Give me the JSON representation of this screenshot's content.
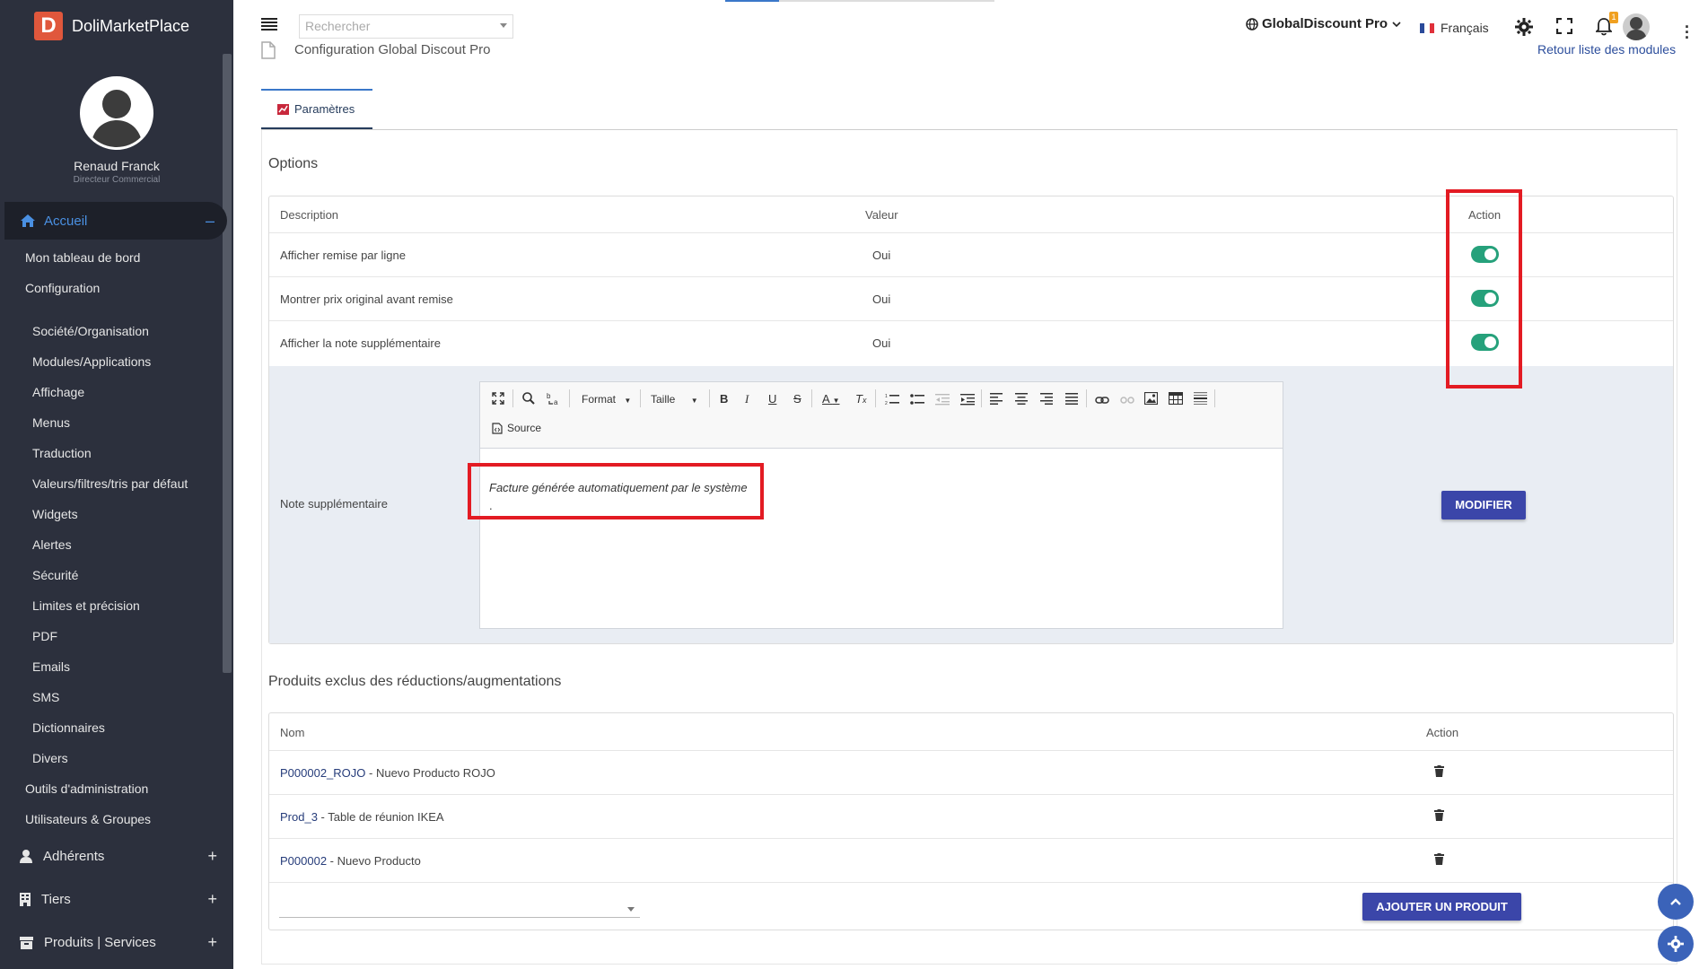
{
  "brand": {
    "logo_letter": "D",
    "name": "DoliMarketPlace"
  },
  "user": {
    "name": "Renaud Franck",
    "role": "Directeur Commercial"
  },
  "sidebar": {
    "main_item": "Accueil",
    "sub_items": [
      "Mon tableau de bord",
      "Configuration"
    ],
    "config_items": [
      "Société/Organisation",
      "Modules/Applications",
      "Affichage",
      "Menus",
      "Traduction",
      "Valeurs/filtres/tris par défaut",
      "Widgets",
      "Alertes",
      "Sécurité",
      "Limites et précision",
      "PDF",
      "Emails",
      "SMS",
      "Dictionnaires",
      "Divers"
    ],
    "admin_items": [
      "Outils d'administration",
      "Utilisateurs & Groupes"
    ],
    "sections": [
      {
        "label": "Adhérents",
        "icon": "user-icon"
      },
      {
        "label": "Tiers",
        "icon": "building-icon"
      },
      {
        "label": "Produits | Services",
        "icon": "box-icon"
      }
    ]
  },
  "topbar": {
    "search_placeholder": "Rechercher",
    "page_title": "Configuration Global Discout Pro",
    "module": "GlobalDiscount Pro",
    "language": "Français",
    "notification_count": "1",
    "back_link": "Retour liste des modules"
  },
  "tabs": [
    {
      "label": "Paramètres",
      "active": true
    }
  ],
  "options": {
    "title": "Options",
    "headers": {
      "description": "Description",
      "value": "Valeur",
      "action": "Action"
    },
    "rows": [
      {
        "description": "Afficher remise par ligne",
        "value": "Oui",
        "enabled": true
      },
      {
        "description": "Montrer prix original avant remise",
        "value": "Oui",
        "enabled": true
      },
      {
        "description": "Afficher la note supplémentaire",
        "value": "Oui",
        "enabled": true
      }
    ],
    "note_label": "Note supplémentaire",
    "note_text": "Facture générée automatiquement par le système",
    "note_text_line2": ".",
    "editor": {
      "format_label": "Format",
      "size_label": "Taille",
      "source_label": "Source"
    },
    "modify_button": "MODIFIER"
  },
  "excluded": {
    "title": "Produits exclus des réductions/augmentations",
    "headers": {
      "name": "Nom",
      "action": "Action"
    },
    "rows": [
      {
        "ref": "P000002_ROJO",
        "label": " - Nuevo Producto ROJO"
      },
      {
        "ref": "Prod_3",
        "label": " - Table de réunion IKEA"
      },
      {
        "ref": "P000002",
        "label": " - Nuevo Producto"
      }
    ],
    "add_button": "AJOUTER UN PRODUIT"
  },
  "colors": {
    "sidebar_bg": "#2c303d",
    "accent": "#3b46a9",
    "toggle_on": "#26a17b",
    "highlight": "#e31b23"
  }
}
